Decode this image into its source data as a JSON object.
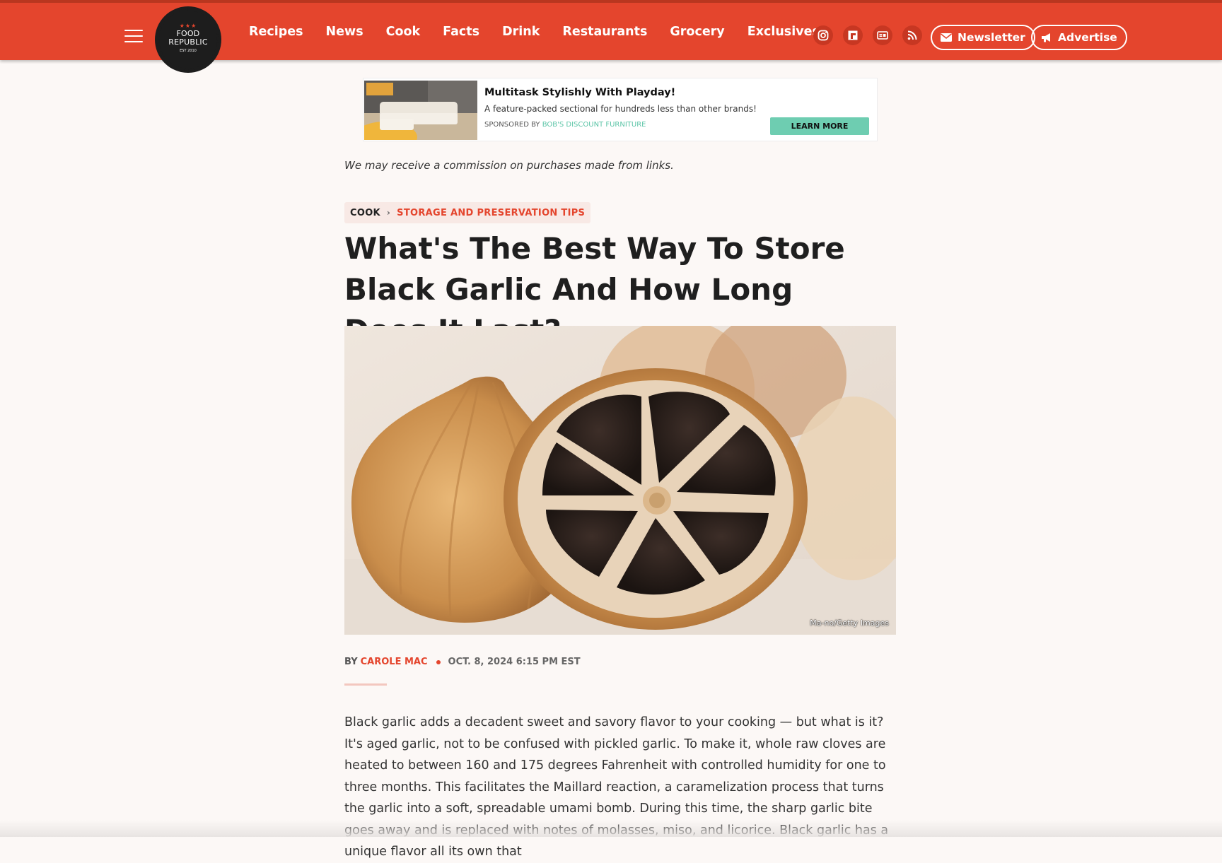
{
  "header": {
    "logo": {
      "stars": "★★★",
      "line1": "FOOD",
      "line2": "REPUBLIC",
      "est": "EST 2010"
    },
    "nav": [
      "Recipes",
      "News",
      "Cook",
      "Facts",
      "Drink",
      "Restaurants",
      "Grocery",
      "Exclusives"
    ],
    "social_icons": [
      "instagram-icon",
      "flipboard-icon",
      "google-news-icon",
      "rss-icon"
    ],
    "newsletter_label": "Newsletter",
    "advertise_label": "Advertise"
  },
  "ad": {
    "title": "Multitask Stylishly With Playday!",
    "description": "A feature-packed sectional for hundreds less than other brands!",
    "sponsored_prefix": "SPONSORED BY",
    "sponsor": "BOB'S DISCOUNT FURNITURE",
    "cta": "LEARN MORE"
  },
  "disclaimer": "We may receive a commission on purchases made from links.",
  "breadcrumb": {
    "parent": "COOK",
    "separator": "›",
    "current": "STORAGE AND PRESERVATION TIPS"
  },
  "article": {
    "title": "What's The Best Way To Store Black Garlic And How Long Does It Last?",
    "image_credit": "Ma-no/Getty Images",
    "by_label": "BY",
    "author": "CAROLE MAC",
    "date": "OCT. 8, 2024 6:15 PM EST",
    "paragraph": "Black garlic adds a decadent sweet and savory flavor to your cooking — but what is it? It's aged garlic, not to be confused with pickled garlic. To make it, whole raw cloves are heated to between 160 and 175 degrees Fahrenheit with controlled humidity for one to three months. This facilitates the Maillard reaction, a caramelization process that turns the garlic into a soft, spreadable umami bomb. During this time, the sharp garlic bite goes away and is replaced with notes of molasses, miso, and licorice. Black garlic has a unique flavor all its own that"
  },
  "colors": {
    "brand": "#e4452d",
    "cta": "#6ecdb1",
    "background": "#fcf8f6"
  }
}
